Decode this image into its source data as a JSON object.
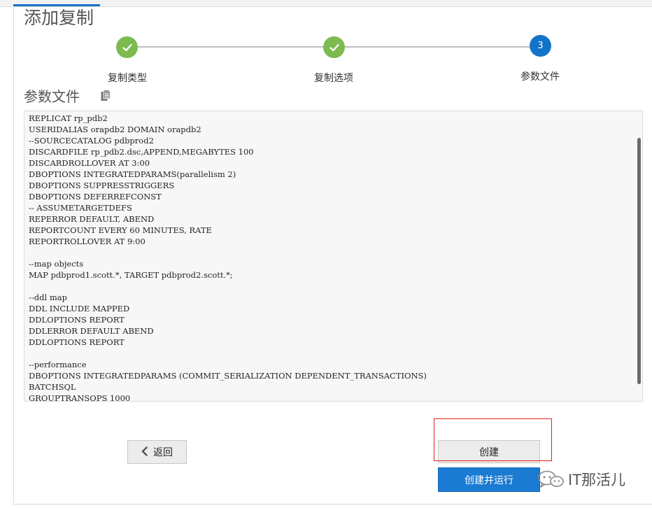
{
  "page": {
    "title": "添加复制"
  },
  "wizard": {
    "steps": [
      {
        "label": "复制类型",
        "state": "completed",
        "indicator": "check-icon"
      },
      {
        "label": "复制选项",
        "state": "completed",
        "indicator": "check-icon"
      },
      {
        "label": "参数文件",
        "state": "current",
        "number": "3"
      }
    ],
    "colors": {
      "completed": "#7dba4f",
      "current": "#1274c9"
    }
  },
  "param_file": {
    "section_title": "参数文件",
    "copy_icon": "copy-icon",
    "lines": [
      "REPLICAT rp_pdb2",
      "USERIDALIAS orapdb2 DOMAIN orapdb2",
      "--SOURCECATALOG pdbprod2",
      "DISCARDFILE rp_pdb2.dsc,APPEND,MEGABYTES 100",
      "DISCARDROLLOVER AT 3:00",
      "DBOPTIONS INTEGRATEDPARAMS(parallelism 2)",
      "DBOPTIONS SUPPRESSTRIGGERS",
      "DBOPTIONS DEFERREFCONST",
      "-- ASSUMETARGETDEFS",
      "REPERROR DEFAULT, ABEND",
      "REPORTCOUNT EVERY 60 MINUTES, RATE",
      "REPORTROLLOVER AT 9:00",
      "",
      "--map objects",
      "MAP pdbprod1.scott.*, TARGET pdbprod2.scott.*;",
      "",
      "--ddl map",
      "DDL INCLUDE MAPPED",
      "DDLOPTIONS REPORT",
      "DDLERROR DEFAULT ABEND",
      "DDLOPTIONS REPORT",
      "",
      "--performance",
      "DBOPTIONS INTEGRATEDPARAMS (COMMIT_SERIALIZATION DEPENDENT_TRANSACTIONS)",
      "BATCHSQL",
      "GROUPTRANSOPS 1000"
    ]
  },
  "buttons": {
    "back": "返回",
    "back_icon": "chevron-left-icon",
    "create": "创建",
    "create_and_run": "创建并运行"
  },
  "watermark": {
    "text": "IT那活儿",
    "icon": "wechat-icon"
  },
  "colors": {
    "primary": "#1b7bd3",
    "highlight": "#e0201b"
  }
}
